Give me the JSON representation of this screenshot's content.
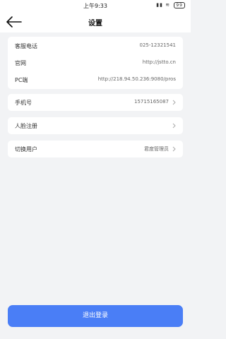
{
  "status_bar": {
    "time": "上午9:33",
    "battery": "99"
  },
  "header": {
    "title": "设置"
  },
  "contact": {
    "phone_label": "客服电话",
    "phone_value": "025-12321541",
    "site_label": "官网",
    "site_value": "http://jstto.cn",
    "pc_label": "PC端",
    "pc_value": "http://218.94.50.236:9080/pros"
  },
  "mobile": {
    "label": "手机号",
    "value": "15715165087"
  },
  "face": {
    "label": "人脸注册"
  },
  "switch_user": {
    "label": "切换用户",
    "value": "君度管理员"
  },
  "logout": {
    "label": "退出登录"
  }
}
